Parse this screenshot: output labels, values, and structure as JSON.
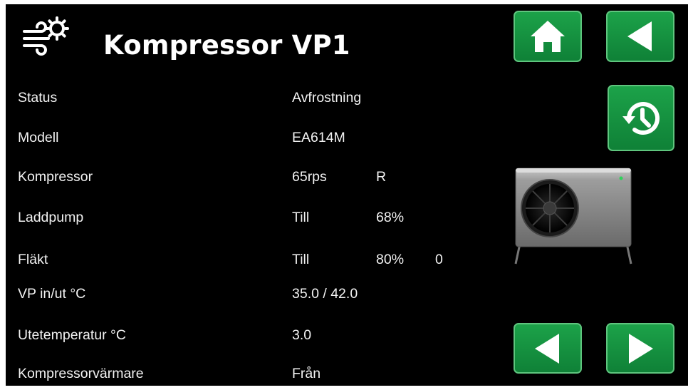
{
  "header": {
    "title": "Kompressor VP1",
    "icon": "heat-pump-fan-gear-icon"
  },
  "navigation": {
    "home_icon": "home-icon",
    "back_icon": "back-arrow-icon",
    "history_icon": "history-clock-icon",
    "prev_icon": "previous-arrow-icon",
    "next_icon": "next-arrow-icon"
  },
  "rows": [
    {
      "label": "Status",
      "value": "Avfrostning",
      "value2": "",
      "value3": ""
    },
    {
      "label": "Modell",
      "value": "EA614M",
      "value2": "",
      "value3": ""
    },
    {
      "label": "Kompressor",
      "value": "65rps",
      "value2": "R",
      "value3": ""
    },
    {
      "label": "Laddpump",
      "value": "Till",
      "value2": "68%",
      "value3": ""
    },
    {
      "label": "Fläkt",
      "value": "Till",
      "value2": "80%",
      "value3": "0"
    },
    {
      "label": "VP in/ut °C",
      "value": "35.0 / 42.0",
      "value2": "",
      "value3": ""
    },
    {
      "label": "Utetemperatur °C",
      "value": "3.0",
      "value2": "",
      "value3": ""
    },
    {
      "label": "Kompressorvärmare",
      "value": "Från",
      "value2": "",
      "value3": ""
    }
  ],
  "colors": {
    "background": "#000000",
    "text": "#ffffff",
    "button_green": "#1a9a45",
    "button_border": "#5fc57e"
  }
}
